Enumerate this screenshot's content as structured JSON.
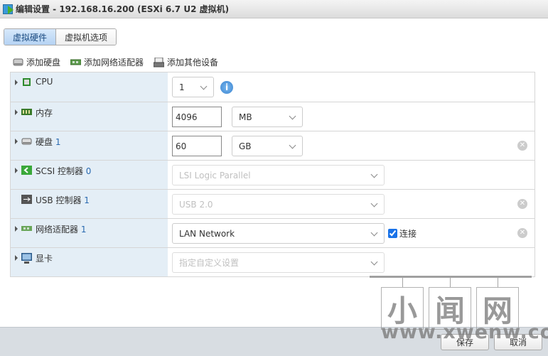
{
  "window": {
    "title": "编辑设置 - 192.168.16.200 (ESXi 6.7 U2 虚拟机)"
  },
  "tabs": [
    {
      "label": "虚拟硬件",
      "active": true
    },
    {
      "label": "虚拟机选项",
      "active": false
    }
  ],
  "toolbar": {
    "add_disk": "添加硬盘",
    "add_nic": "添加网络适配器",
    "add_other": "添加其他设备"
  },
  "hardware": {
    "cpu": {
      "label": "CPU",
      "value": "1"
    },
    "memory": {
      "label": "内存",
      "value": "4096",
      "unit": "MB"
    },
    "disk": {
      "label": "硬盘",
      "num": "1",
      "value": "60",
      "unit": "GB"
    },
    "scsi": {
      "label": "SCSI 控制器",
      "num": "0",
      "value": "LSI Logic Parallel"
    },
    "usb": {
      "label": "USB 控制器",
      "num": "1",
      "value": "USB 2.0"
    },
    "nic": {
      "label": "网络适配器",
      "num": "1",
      "value": "LAN Network",
      "connect_label": "连接",
      "connected": true
    },
    "video": {
      "label": "显卡",
      "value": "指定自定义设置"
    }
  },
  "footer": {
    "save": "保存",
    "cancel": "取消"
  },
  "watermark": {
    "chars": [
      "小",
      "闻",
      "网"
    ],
    "url": "www.xwenw.com"
  }
}
